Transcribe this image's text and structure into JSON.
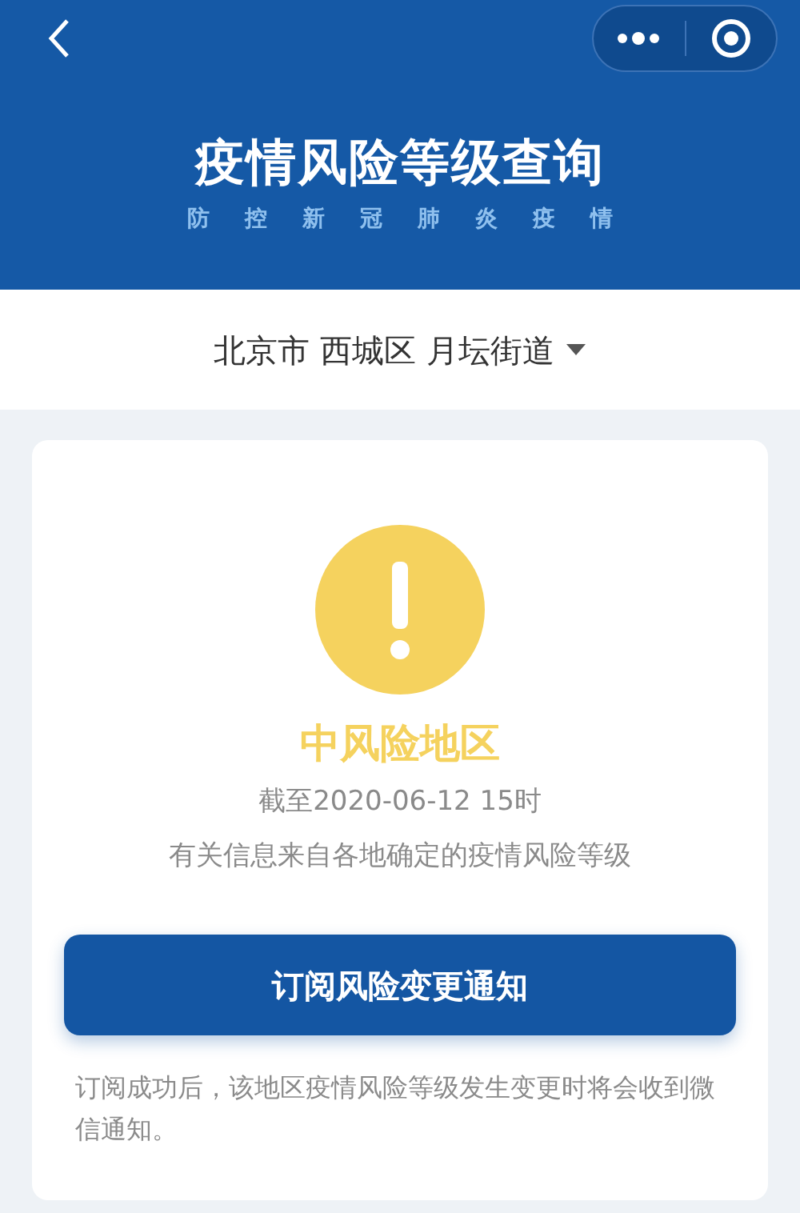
{
  "header": {
    "title": "疫情风险等级查询",
    "subtitle": [
      "防",
      "控",
      "新",
      "冠",
      "肺",
      "炎",
      "疫",
      "情"
    ]
  },
  "location": {
    "text": "北京市 西城区 月坛街道"
  },
  "result": {
    "risk_level": "中风险地区",
    "color": "#f5d25e",
    "updated": "截至2020-06-12 15时",
    "source": "有关信息来自各地确定的疫情风险等级"
  },
  "subscribe_button": "订阅风险变更通知",
  "note": "订阅成功后，该地区疫情风险等级发生变更时将会收到微信通知。"
}
